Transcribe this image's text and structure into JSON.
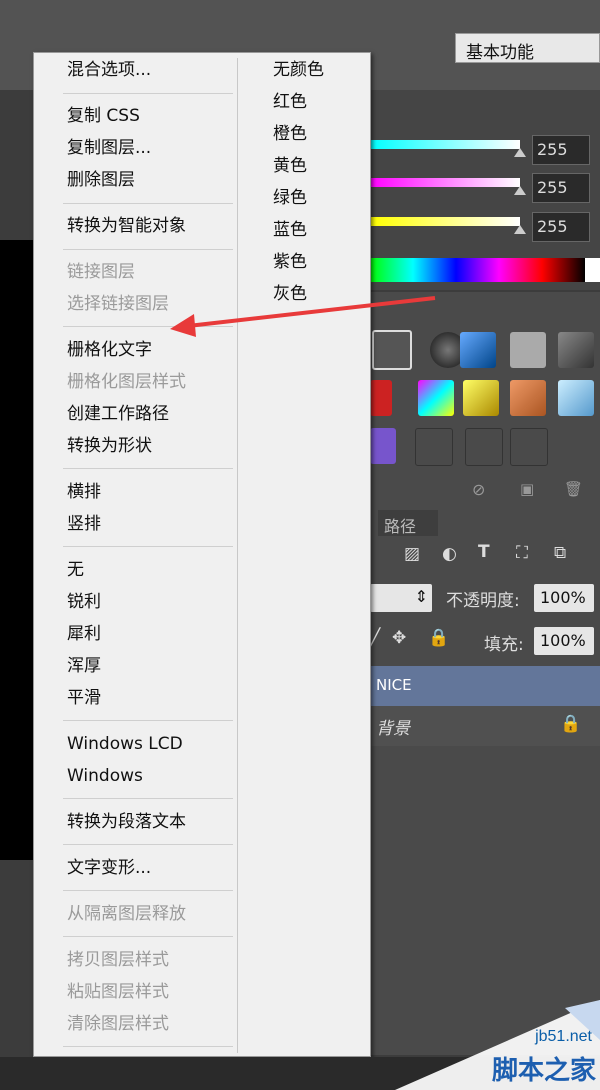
{
  "workspace": {
    "label": "基本功能"
  },
  "color_panel": {
    "channels": [
      {
        "value": "255",
        "color": "#00ffff"
      },
      {
        "value": "255",
        "color": "#ff00ff"
      },
      {
        "value": "255",
        "color": "#ffff00"
      }
    ]
  },
  "layers_panel": {
    "paths_tab": "路径",
    "opacity_label": "不透明度:",
    "opacity_value": "100%",
    "fill_label": "填充:",
    "fill_value": "100%",
    "layers": [
      {
        "name": "NICE"
      },
      {
        "name": "背景"
      }
    ],
    "filter_icons": [
      "image-icon",
      "circle-half-icon",
      "text-icon",
      "transform-icon",
      "smart-object-icon"
    ]
  },
  "context_menu": {
    "groups": [
      [
        {
          "label": "混合选项...",
          "enabled": true
        }
      ],
      [
        {
          "label": "复制 CSS",
          "enabled": true
        },
        {
          "label": "复制图层...",
          "enabled": true
        },
        {
          "label": "删除图层",
          "enabled": true
        }
      ],
      [
        {
          "label": "转换为智能对象",
          "enabled": true
        }
      ],
      [
        {
          "label": "链接图层",
          "enabled": false
        },
        {
          "label": "选择链接图层",
          "enabled": false
        }
      ],
      [
        {
          "label": "栅格化文字",
          "enabled": true
        },
        {
          "label": "栅格化图层样式",
          "enabled": false
        },
        {
          "label": "创建工作路径",
          "enabled": true
        },
        {
          "label": "转换为形状",
          "enabled": true
        }
      ],
      [
        {
          "label": "横排",
          "enabled": true
        },
        {
          "label": "竖排",
          "enabled": true
        }
      ],
      [
        {
          "label": "无",
          "enabled": true
        },
        {
          "label": "锐利",
          "enabled": true
        },
        {
          "label": "犀利",
          "enabled": true
        },
        {
          "label": "浑厚",
          "enabled": true
        },
        {
          "label": "平滑",
          "enabled": true
        }
      ],
      [
        {
          "label": "Windows LCD",
          "enabled": true
        },
        {
          "label": "Windows",
          "enabled": true
        }
      ],
      [
        {
          "label": "转换为段落文本",
          "enabled": true
        }
      ],
      [
        {
          "label": "文字变形...",
          "enabled": true
        }
      ],
      [
        {
          "label": "从隔离图层释放",
          "enabled": false
        }
      ],
      [
        {
          "label": "拷贝图层样式",
          "enabled": false
        },
        {
          "label": "粘贴图层样式",
          "enabled": false
        },
        {
          "label": "清除图层样式",
          "enabled": false
        }
      ]
    ],
    "colors": [
      "无颜色",
      "红色",
      "橙色",
      "黄色",
      "绿色",
      "蓝色",
      "紫色",
      "灰色"
    ]
  },
  "annotation": {
    "arrow_color": "#e83a3a",
    "points_to": "栅格化文字"
  },
  "watermark": {
    "url": "jb51.net",
    "brand": "脚本之家"
  }
}
